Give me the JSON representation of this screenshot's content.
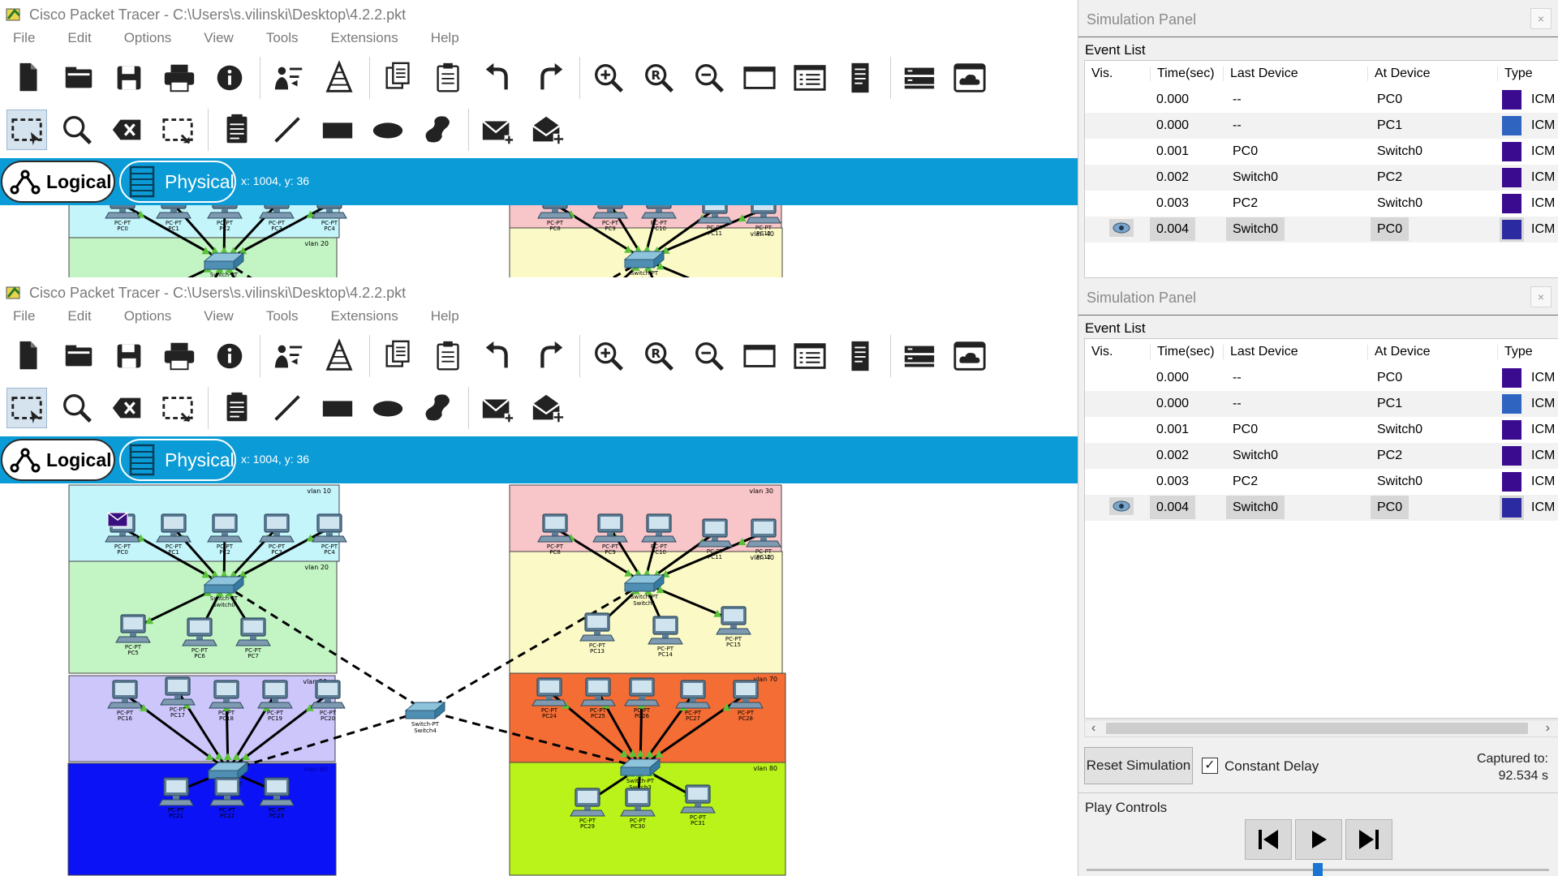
{
  "window": {
    "title": "Cisco Packet Tracer - C:\\Users\\s.vilinski\\Desktop\\4.2.2.pkt",
    "menus": [
      "File",
      "Edit",
      "Options",
      "View",
      "Tools",
      "Extensions",
      "Help"
    ]
  },
  "toolbar_icons": [
    "new-file-icon",
    "open-folder-icon",
    "save-icon",
    "print-icon",
    "info-icon",
    "activity-wizard-icon",
    "network-info-icon",
    "copy-icon",
    "paste-icon",
    "undo-icon",
    "redo-icon",
    "zoom-in-icon",
    "zoom-reset-icon",
    "zoom-out-icon",
    "drawing-palette-icon",
    "custom-devices-icon",
    "viewport-icon",
    "pdu-list-icon",
    "cloud-icon"
  ],
  "tool_icons": [
    "select-icon",
    "inspect-icon",
    "delete-icon",
    "resize-icon",
    "place-note-icon",
    "draw-line-icon",
    "rectangle-icon",
    "ellipse-icon",
    "freeform-icon",
    "add-simple-pdu-icon",
    "add-complex-pdu-icon"
  ],
  "modes": {
    "logical": "Logical",
    "physical": "Physical",
    "coords": "x: 1004, y: 36"
  },
  "sim": {
    "title": "Simulation Panel",
    "close": "×",
    "event_list_label": "Event List",
    "headers": {
      "vis": "Vis.",
      "time": "Time(sec)",
      "last": "Last Device",
      "at": "At Device",
      "type": "Type"
    },
    "events": [
      {
        "time": "0.000",
        "last": "--",
        "at": "PC0",
        "type": "ICM",
        "color": "#3b0b8f"
      },
      {
        "time": "0.000",
        "last": "--",
        "at": "PC1",
        "type": "ICM",
        "color": "#2f64c0"
      },
      {
        "time": "0.001",
        "last": "PC0",
        "at": "Switch0",
        "type": "ICM",
        "color": "#3b0b8f"
      },
      {
        "time": "0.002",
        "last": "Switch0",
        "at": "PC2",
        "type": "ICM",
        "color": "#3b0b8f"
      },
      {
        "time": "0.003",
        "last": "PC2",
        "at": "Switch0",
        "type": "ICM",
        "color": "#3b0b8f"
      },
      {
        "time": "0.004",
        "last": "Switch0",
        "at": "PC0",
        "type": "ICM",
        "color": "#2b2aa0"
      }
    ],
    "reset_label": "Reset Simulation",
    "constant_delay_label": "Constant Delay",
    "captured_label": "Captured to:",
    "captured_value": "92.534 s",
    "play_controls_label": "Play Controls"
  },
  "topology": {
    "vlans": [
      {
        "label": "vlan 10",
        "color": "#c4f5fb"
      },
      {
        "label": "vlan 20",
        "color": "#c3f5c4"
      },
      {
        "label": "vlan 30",
        "color": "#f8c5c8"
      },
      {
        "label": "vlan 40",
        "color": "#fbfac7"
      },
      {
        "label": "vlan 50",
        "color": "#cdc6fa"
      },
      {
        "label": "vlan 60",
        "color": "#0b12f5"
      },
      {
        "label": "vlan 70",
        "color": "#f46d35"
      },
      {
        "label": "vlan 80",
        "color": "#b9f319"
      }
    ],
    "pc_type": "PC-PT",
    "switch_type": "Switch-PT",
    "pcs": [
      "PC0",
      "PC1",
      "PC2",
      "PC3",
      "PC4",
      "PC5",
      "PC6",
      "PC7",
      "PC8",
      "PC9",
      "PC10",
      "PC11",
      "PC12",
      "PC13",
      "PC14",
      "PC15",
      "PC16",
      "PC17",
      "PC18",
      "PC19",
      "PC20",
      "PC21",
      "PC22",
      "PC23",
      "PC24",
      "PC25",
      "PC26",
      "PC27",
      "PC28",
      "PC29",
      "PC30",
      "PC31"
    ],
    "switches": [
      "Switch0",
      "Switch1",
      "Switch2",
      "Switch3",
      "Switch4"
    ]
  }
}
